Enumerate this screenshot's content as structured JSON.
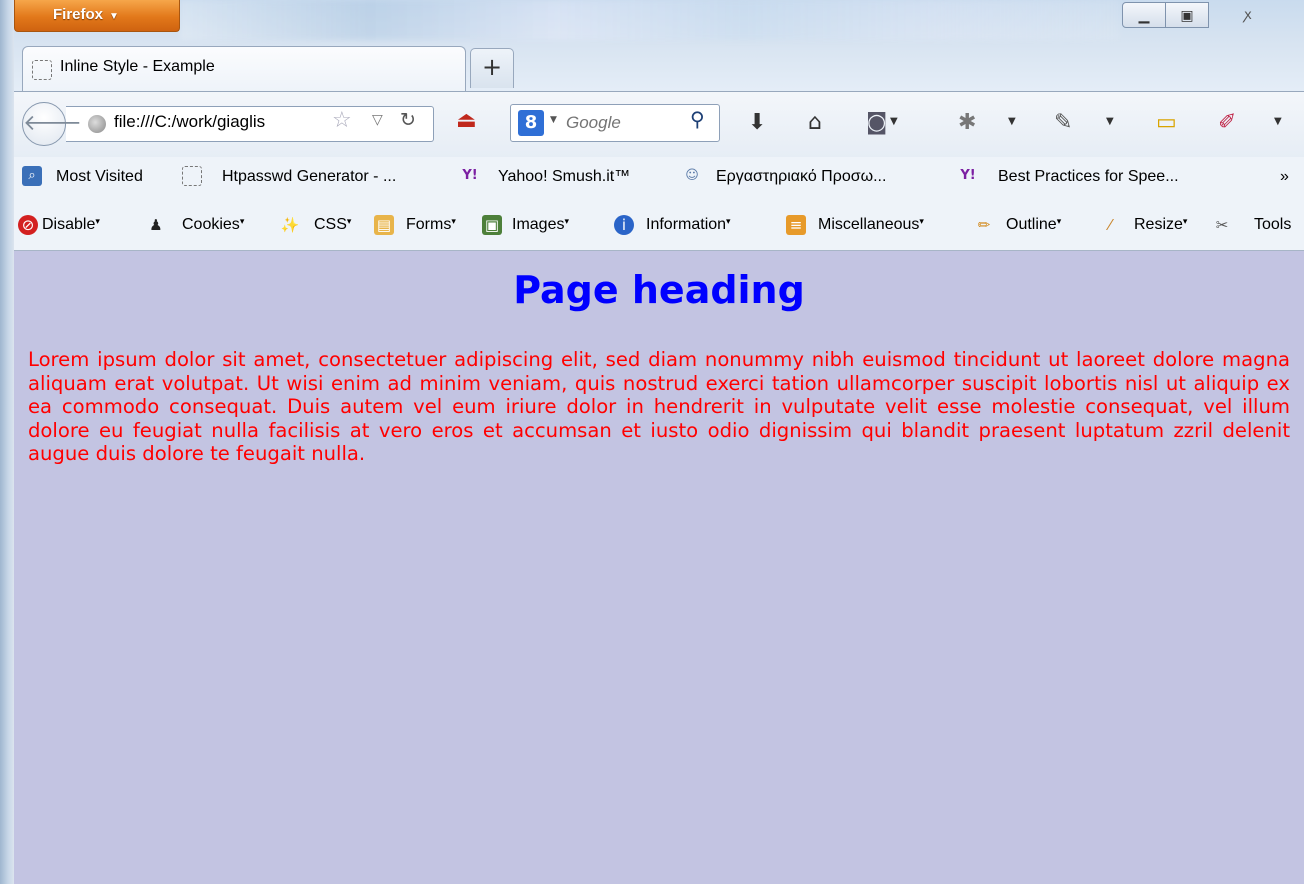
{
  "window": {
    "firefox_menu_label": "Firefox",
    "close_glyph": "ꭗ"
  },
  "tabs": [
    {
      "title": "Inline Style - Example",
      "active": true
    }
  ],
  "new_tab_label": "+",
  "navbar": {
    "url": "file:///C:/work/giaglis",
    "search_placeholder": "Google",
    "search_engine_label": "8"
  },
  "bookmarks": {
    "items": [
      {
        "label": "Most Visited",
        "icon": "most-visited-icon"
      },
      {
        "label": "Htpasswd Generator - ...",
        "icon": "page-icon"
      },
      {
        "label": "Yahoo! Smush.it™",
        "icon": "yahoo-icon"
      },
      {
        "label": "Εργαστηριακό Προσω...",
        "icon": "chat-icon"
      },
      {
        "label": "Best Practices for Spee...",
        "icon": "yahoo-icon"
      }
    ],
    "overflow_label": "»"
  },
  "web_developer": {
    "items": [
      {
        "label": "Disable",
        "icon": "disable-icon"
      },
      {
        "label": "Cookies",
        "icon": "cookies-icon"
      },
      {
        "label": "CSS",
        "icon": "css-wand-icon"
      },
      {
        "label": "Forms",
        "icon": "forms-icon"
      },
      {
        "label": "Images",
        "icon": "images-icon"
      },
      {
        "label": "Information",
        "icon": "information-icon"
      },
      {
        "label": "Miscellaneous",
        "icon": "miscellaneous-icon"
      },
      {
        "label": "Outline",
        "icon": "outline-pencil-icon"
      },
      {
        "label": "Resize",
        "icon": "resize-ruler-icon"
      },
      {
        "label": "Tools",
        "icon": "tools-icon"
      }
    ]
  },
  "page": {
    "heading": "Page heading",
    "paragraph": "Lorem ipsum dolor sit amet, consectetuer adipiscing elit, sed diam nonummy nibh euismod tincidunt ut laoreet dolore magna aliquam erat volutpat. Ut wisi enim ad minim veniam, quis nostrud exerci tation ullamcorper suscipit lobortis nisl ut aliquip ex ea commodo consequat. Duis autem vel eum iriure dolor in hendrerit in vulputate velit esse molestie consequat, vel illum dolore eu feugiat nulla facilisis at vero eros et accumsan et iusto odio dignissim qui blandit praesent luptatum zzril delenit augue duis dolore te feugait nulla.",
    "heading_color": "#0000ff",
    "text_color": "#ff0000",
    "background_color": "#c3c4e2"
  }
}
